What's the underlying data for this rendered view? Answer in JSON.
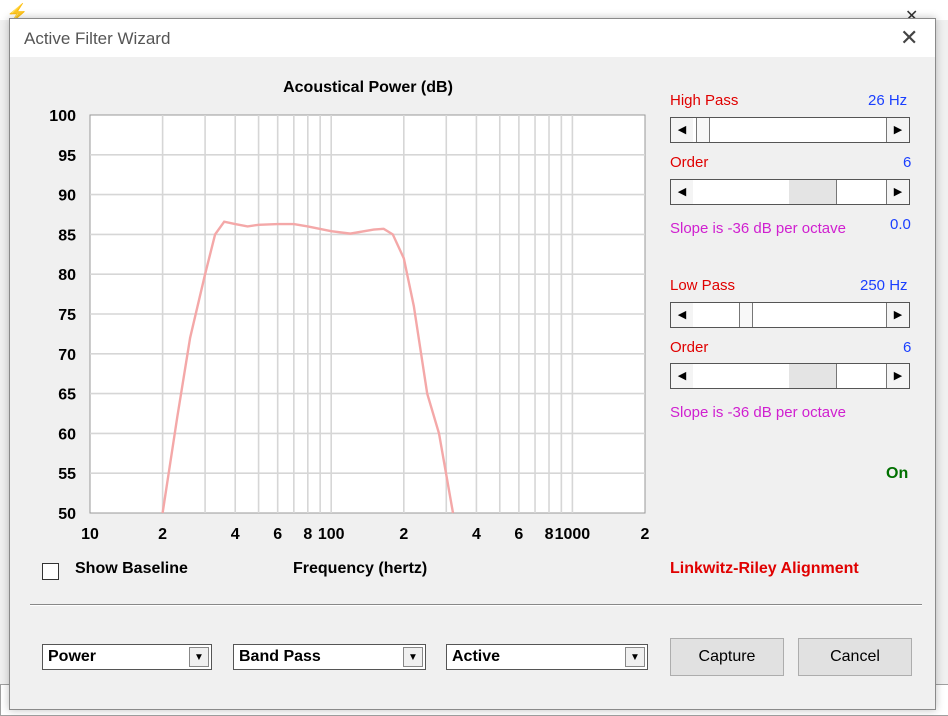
{
  "dialog": {
    "title": "Active Filter Wizard"
  },
  "chart_data": {
    "type": "line",
    "title": "Acoustical Power (dB)",
    "xlabel": "Frequency (hertz)",
    "ylabel": "",
    "x_scale": "log",
    "xlim": [
      10,
      2000
    ],
    "ylim": [
      50,
      100
    ],
    "y_ticks": [
      100,
      95,
      90,
      85,
      80,
      75,
      70,
      65,
      60,
      55,
      50
    ],
    "x_tick_labels": [
      "10",
      "2",
      "4",
      "6",
      "8",
      "100",
      "2",
      "4",
      "6",
      "8",
      "1000",
      "2"
    ],
    "line_color": "#f4a8a8",
    "series": [
      {
        "x": [
          20,
          23,
          26,
          30,
          33,
          36,
          40,
          45,
          50,
          60,
          70,
          80,
          100,
          120,
          150,
          165,
          180,
          200,
          220,
          250,
          280,
          320
        ],
        "y": [
          50,
          62,
          72,
          80,
          85,
          86.6,
          86.3,
          86.0,
          86.2,
          86.3,
          86.3,
          86.0,
          85.4,
          85.1,
          85.6,
          85.7,
          85.0,
          82.0,
          76.0,
          65.0,
          60.0,
          50.0
        ]
      }
    ]
  },
  "high_pass": {
    "label": "High Pass",
    "value": "26 Hz",
    "order_label": "Order",
    "order_value": "6",
    "slope_text": "Slope is -36 dB per octave",
    "q_value": "0.0"
  },
  "low_pass": {
    "label": "Low Pass",
    "value": "250 Hz",
    "order_label": "Order",
    "order_value": "6",
    "slope_text": "Slope is -36 dB per octave"
  },
  "status": "On",
  "show_baseline_label": "Show Baseline",
  "alignment": "Linkwitz-Riley Alignment",
  "combos": {
    "mode": "Power",
    "filter_type": "Band Pass",
    "filter_kind": "Active"
  },
  "buttons": {
    "capture": "Capture",
    "cancel": "Cancel"
  },
  "colors": {
    "red_label": "#e00000",
    "blue_value": "#1a3fff",
    "magenta_text": "#d020d0",
    "on_green": "#007000"
  }
}
